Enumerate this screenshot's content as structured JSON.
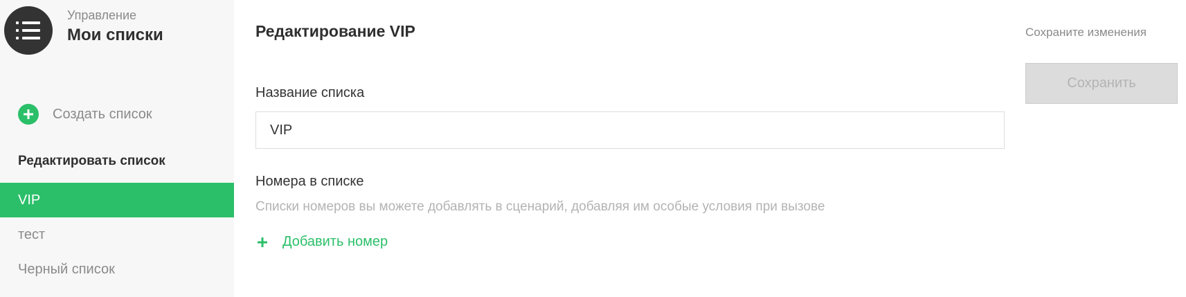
{
  "header": {
    "subtitle": "Управление",
    "title": "Мои списки",
    "menu_icon": "list-menu-icon"
  },
  "sidebar": {
    "create_label": "Создать список",
    "edit_section_label": "Редактировать список",
    "lists": [
      {
        "label": "VIP",
        "active": true
      },
      {
        "label": "тест",
        "active": false
      },
      {
        "label": "Черный список",
        "active": false
      }
    ]
  },
  "main": {
    "title": "Редактирование VIP",
    "name_field": {
      "label": "Название списка",
      "value": "VIP"
    },
    "numbers": {
      "label": "Номера в списке",
      "hint": "Списки номеров вы можете добавлять в сценарий, добавляя им особые условия при вызове",
      "add_label": "Добавить номер"
    }
  },
  "actions": {
    "save_hint": "Сохраните изменения",
    "save_label": "Сохранить",
    "save_enabled": false
  },
  "colors": {
    "accent": "#2bbf69",
    "sidebar_bg": "#f7f7f7",
    "menu_button_bg": "#333333",
    "disabled_button_bg": "#dcdcdc"
  }
}
